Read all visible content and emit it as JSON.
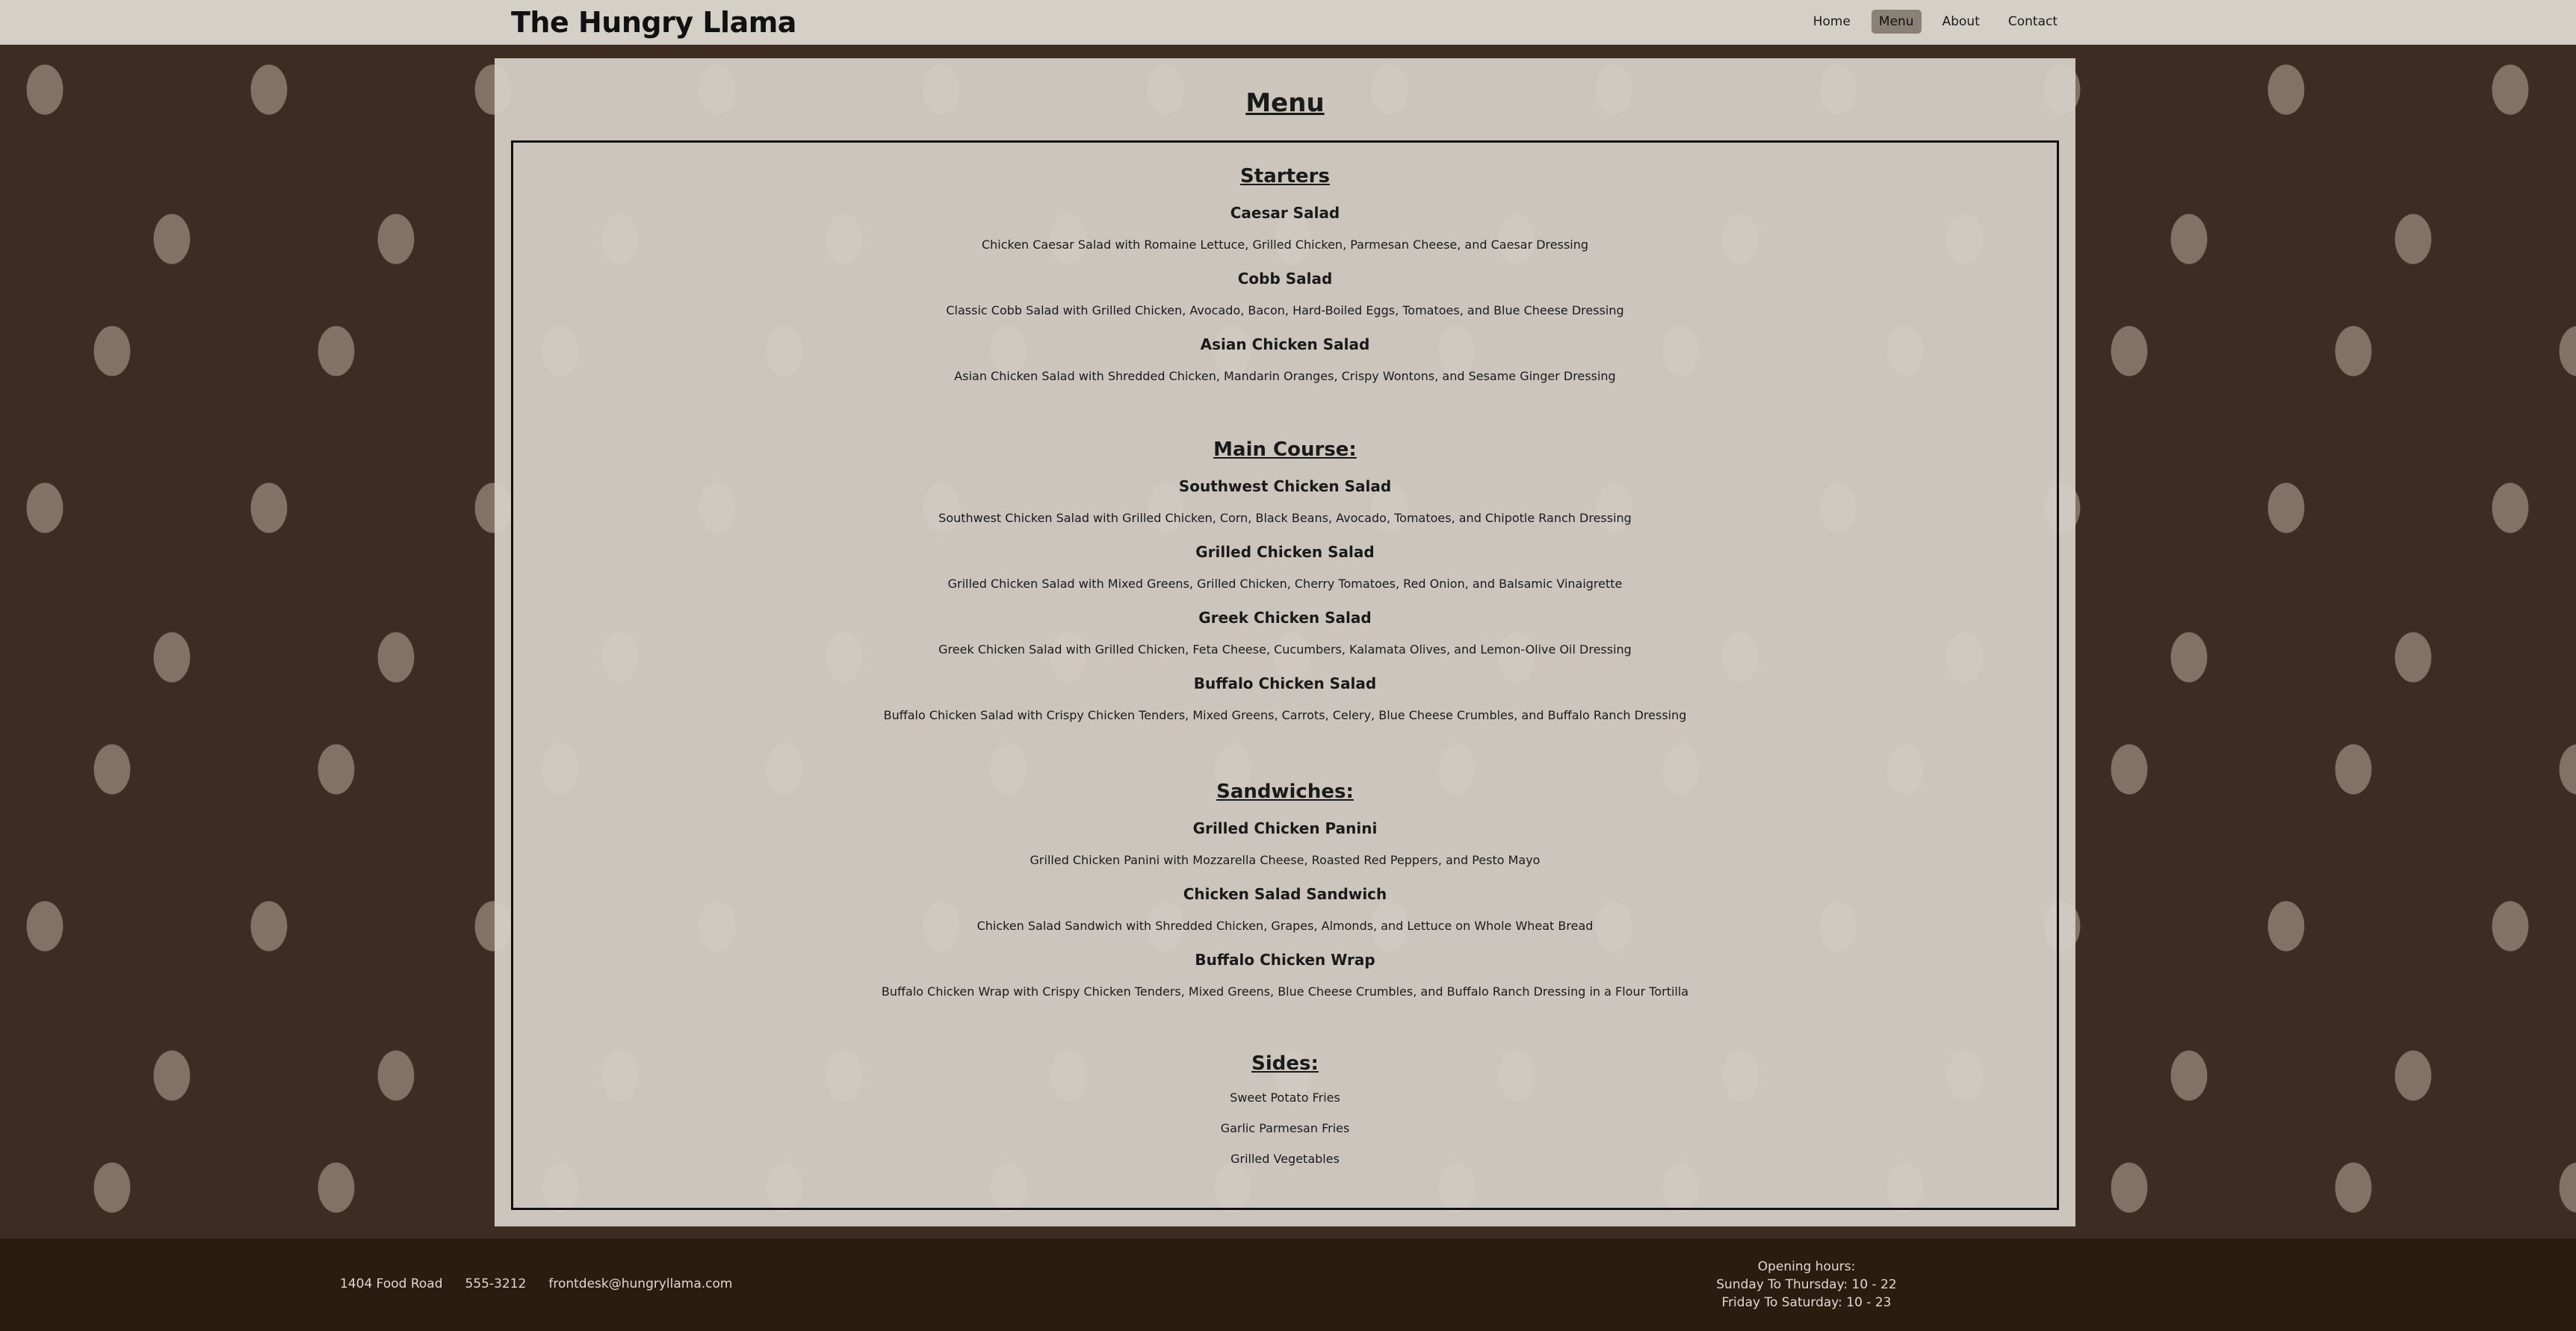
{
  "header": {
    "brand": "The Hungry Llama",
    "nav": [
      {
        "label": "Home",
        "active": false
      },
      {
        "label": "Menu",
        "active": true
      },
      {
        "label": "About",
        "active": false
      },
      {
        "label": "Contact",
        "active": false
      }
    ]
  },
  "page": {
    "title": "Menu"
  },
  "menu": {
    "starters": {
      "title": "Starters",
      "items": [
        {
          "name": "Caesar Salad",
          "desc": "Chicken Caesar Salad with Romaine Lettuce, Grilled Chicken, Parmesan Cheese, and Caesar Dressing"
        },
        {
          "name": "Cobb Salad",
          "desc": "Classic Cobb Salad with Grilled Chicken, Avocado, Bacon, Hard-Boiled Eggs, Tomatoes, and Blue Cheese Dressing"
        },
        {
          "name": "Asian Chicken Salad",
          "desc": "Asian Chicken Salad with Shredded Chicken, Mandarin Oranges, Crispy Wontons, and Sesame Ginger Dressing"
        }
      ]
    },
    "main": {
      "title": "Main Course:",
      "items": [
        {
          "name": "Southwest Chicken Salad",
          "desc": "Southwest Chicken Salad with Grilled Chicken, Corn, Black Beans, Avocado, Tomatoes, and Chipotle Ranch Dressing"
        },
        {
          "name": "Grilled Chicken Salad",
          "desc": "Grilled Chicken Salad with Mixed Greens, Grilled Chicken, Cherry Tomatoes, Red Onion, and Balsamic Vinaigrette"
        },
        {
          "name": "Greek Chicken Salad",
          "desc": "Greek Chicken Salad with Grilled Chicken, Feta Cheese, Cucumbers, Kalamata Olives, and Lemon-Olive Oil Dressing"
        },
        {
          "name": "Buffalo Chicken Salad",
          "desc": "Buffalo Chicken Salad with Crispy Chicken Tenders, Mixed Greens, Carrots, Celery, Blue Cheese Crumbles, and Buffalo Ranch Dressing"
        }
      ]
    },
    "sandwiches": {
      "title": "Sandwiches:",
      "items": [
        {
          "name": "Grilled Chicken Panini",
          "desc": "Grilled Chicken Panini with Mozzarella Cheese, Roasted Red Peppers, and Pesto Mayo"
        },
        {
          "name": "Chicken Salad Sandwich",
          "desc": "Chicken Salad Sandwich with Shredded Chicken, Grapes, Almonds, and Lettuce on Whole Wheat Bread"
        },
        {
          "name": "Buffalo Chicken Wrap",
          "desc": "Buffalo Chicken Wrap with Crispy Chicken Tenders, Mixed Greens, Blue Cheese Crumbles, and Buffalo Ranch Dressing in a Flour Tortilla"
        }
      ]
    },
    "sides": {
      "title": "Sides:",
      "items": [
        "Sweet Potato Fries",
        "Garlic Parmesan Fries",
        "Grilled Vegetables"
      ]
    }
  },
  "footer": {
    "address": "1404 Food Road",
    "phone": "555-3212",
    "email": "frontdesk@hungryllama.com",
    "hours_title": "Opening hours:",
    "hours_weekday": "Sunday To Thursday: 10 - 22",
    "hours_weekend": "Friday To Saturday: 10 - 23"
  },
  "colors": {
    "background": "#3e2c23",
    "header": "#d4cfc7",
    "nav_active": "#8a8176",
    "footer": "#2b1c10"
  }
}
